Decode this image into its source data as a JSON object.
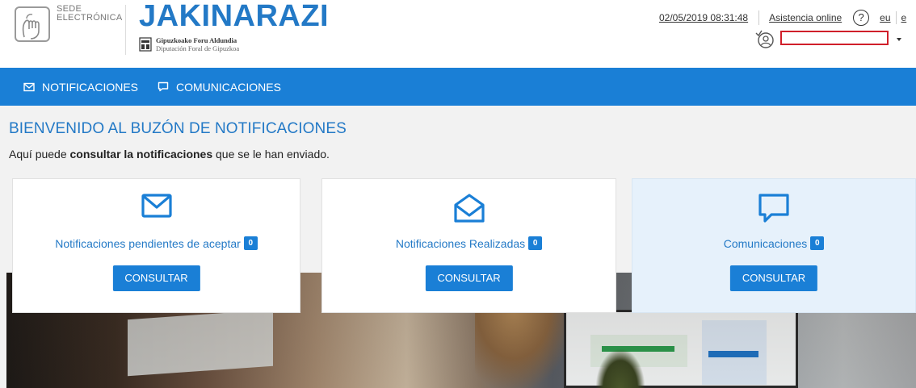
{
  "header": {
    "sede_line1": "SEDE",
    "sede_line2": "ELECTRÓNICA",
    "app_title": "JAKINARAZI",
    "org_eu": "Gipuzkoako Foru Aldundia",
    "org_es": "Diputación Foral de Gipuzkoa",
    "datetime": "02/05/2019  08:31:48",
    "asistencia": "Asistencia online",
    "help_symbol": "?",
    "lang_eu": "eu",
    "lang_es": "e",
    "user_field_value": ""
  },
  "nav": {
    "items": [
      {
        "label": "NOTIFICACIONES",
        "icon": "envelope-icon"
      },
      {
        "label": "COMUNICACIONES",
        "icon": "speech-bubble-icon"
      }
    ]
  },
  "main": {
    "welcome_title": "BIENVENIDO AL BUZÓN DE NOTIFICACIONES",
    "subtitle_pre": "Aquí puede ",
    "subtitle_bold": "consultar la notificaciones",
    "subtitle_post": " que se le han enviado."
  },
  "cards": [
    {
      "label": "Notificaciones pendientes de aceptar",
      "count": "0",
      "button": "CONSULTAR",
      "icon": "envelope-icon"
    },
    {
      "label": "Notificaciones Realizadas",
      "count": "0",
      "button": "CONSULTAR",
      "icon": "envelope-open-icon"
    },
    {
      "label": "Comunicaciones",
      "count": "0",
      "button": "CONSULTAR",
      "icon": "speech-bubble-icon"
    }
  ],
  "colors": {
    "brand_blue": "#1a7fd6",
    "title_blue": "#2379c6",
    "highlight_card": "#e6f1fb",
    "annotation_red": "#d01f2a"
  }
}
